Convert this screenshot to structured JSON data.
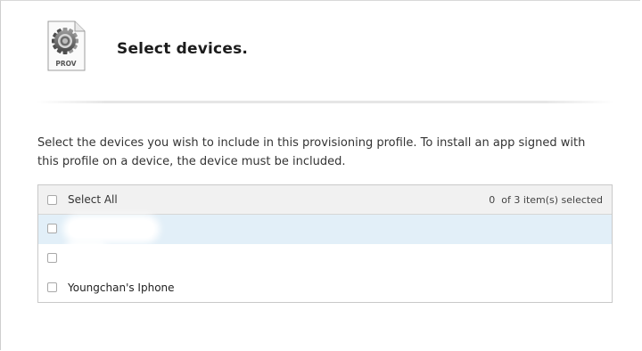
{
  "header": {
    "file_icon_label": "PROV",
    "title": "Select devices."
  },
  "description": "Select the devices you wish to include in this provisioning profile. To install an app signed with this profile on a device, the device must be included.",
  "device_table": {
    "select_all_label": "Select All",
    "selected_count": "0",
    "selected_suffix": "of 3 item(s) selected",
    "rows": [
      {
        "name": "",
        "checked": false,
        "highlighted": true
      },
      {
        "name": "",
        "checked": false,
        "highlighted": false
      },
      {
        "name": "Youngchan's Iphone",
        "checked": false,
        "highlighted": false
      }
    ]
  },
  "colors": {
    "row_highlight": "#e2eff8",
    "header_background": "#f1f1f1",
    "table_border": "#c9c9c9"
  }
}
